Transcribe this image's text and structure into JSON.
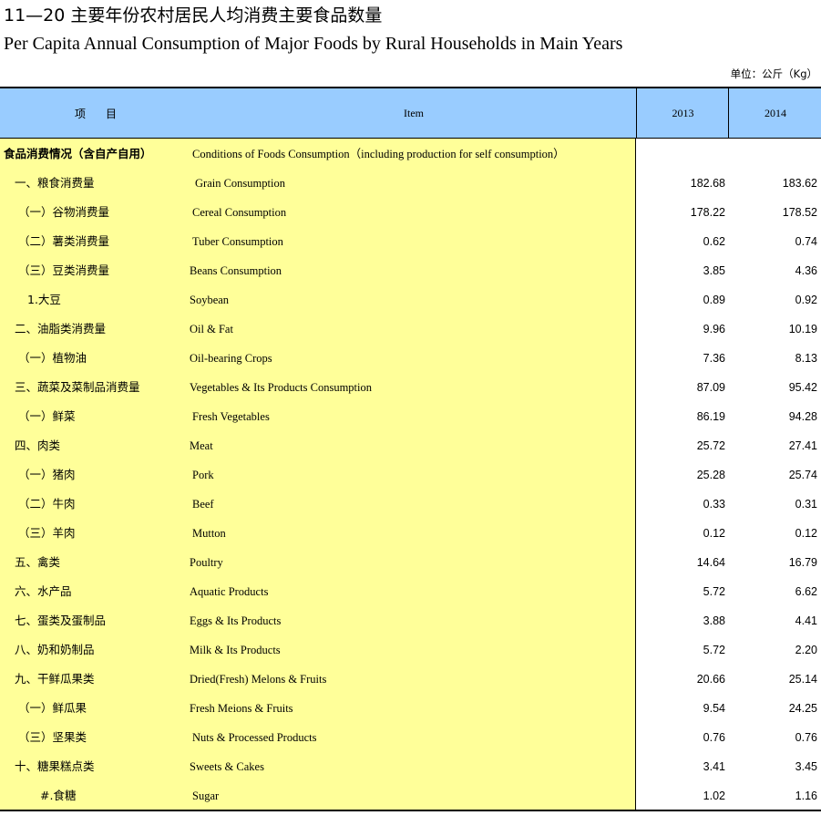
{
  "title_cn": "11—20 主要年份农村居民人均消费主要食品数量",
  "title_en": "Per Capita Annual Consumption of Major Foods by  Rural Households in Main Years",
  "unit": "单位：公斤（Kg）",
  "header": {
    "item_cn": "项目",
    "item_en": "Item",
    "year1": "2013",
    "year2": "2014"
  },
  "rows": [
    {
      "cn": "食品消费情况（含自产自用）",
      "en": "Conditions of Foods Consumption（including production for self consumption）",
      "v2013": "",
      "v2014": ""
    },
    {
      "cn": "一、粮食消费量",
      "en": "Grain Consumption",
      "v2013": "182.68",
      "v2014": "183.62"
    },
    {
      "cn": "（一）谷物消费量",
      "en": "Cereal  Consumption",
      "v2013": "178.22",
      "v2014": "178.52"
    },
    {
      "cn": "（二）薯类消费量",
      "en": "Tuber  Consumption",
      "v2013": "0.62",
      "v2014": "0.74"
    },
    {
      "cn": "（三）豆类消费量",
      "en": "Beans Consumption",
      "v2013": "3.85",
      "v2014": "4.36"
    },
    {
      "cn": "1.大豆",
      "en": "Soybean",
      "v2013": "0.89",
      "v2014": "0.92"
    },
    {
      "cn": "二、油脂类消费量",
      "en": "Oil & Fat",
      "v2013": "9.96",
      "v2014": "10.19"
    },
    {
      "cn": "（一）植物油",
      "en": "Oil-bearing Crops",
      "v2013": "7.36",
      "v2014": "8.13"
    },
    {
      "cn": "三、蔬菜及菜制品消费量",
      "en": "Vegetables &  Its Products Consumption",
      "v2013": "87.09",
      "v2014": "95.42"
    },
    {
      "cn": "（一）鲜菜",
      "en": "Fresh Vegetables",
      "v2013": "86.19",
      "v2014": "94.28"
    },
    {
      "cn": "四、肉类",
      "en": "Meat",
      "v2013": "25.72",
      "v2014": "27.41"
    },
    {
      "cn": "（一）猪肉",
      "en": "Pork",
      "v2013": "25.28",
      "v2014": "25.74"
    },
    {
      "cn": "（二）牛肉",
      "en": "Beef",
      "v2013": "0.33",
      "v2014": "0.31"
    },
    {
      "cn": "（三）羊肉",
      "en": "Mutton",
      "v2013": "0.12",
      "v2014": "0.12"
    },
    {
      "cn": "五、禽类",
      "en": "Poultry",
      "v2013": "14.64",
      "v2014": "16.79"
    },
    {
      "cn": "六、水产品",
      "en": "Aquatic Products",
      "v2013": "5.72",
      "v2014": "6.62"
    },
    {
      "cn": "七、蛋类及蛋制品",
      "en": "Eggs  &  Its Products",
      "v2013": "3.88",
      "v2014": "4.41"
    },
    {
      "cn": "八、奶和奶制品",
      "en": "Milk & Its Products",
      "v2013": "5.72",
      "v2014": "2.20"
    },
    {
      "cn": "九、干鲜瓜果类",
      "en": "Dried(Fresh) Melons & Fruits",
      "v2013": "20.66",
      "v2014": "25.14"
    },
    {
      "cn": "（一）鲜瓜果",
      "en": "Fresh Meions  & Fruits",
      "v2013": "9.54",
      "v2014": "24.25"
    },
    {
      "cn": "（三）坚果类",
      "en": "Nuts & Processed Products",
      "v2013": "0.76",
      "v2014": "0.76"
    },
    {
      "cn": "十、糖果糕点类",
      "en": "Sweets & Cakes",
      "v2013": "3.41",
      "v2014": "3.45"
    },
    {
      "cn": "#.食糖",
      "en": "Sugar",
      "v2013": "1.02",
      "v2014": "1.16"
    }
  ]
}
